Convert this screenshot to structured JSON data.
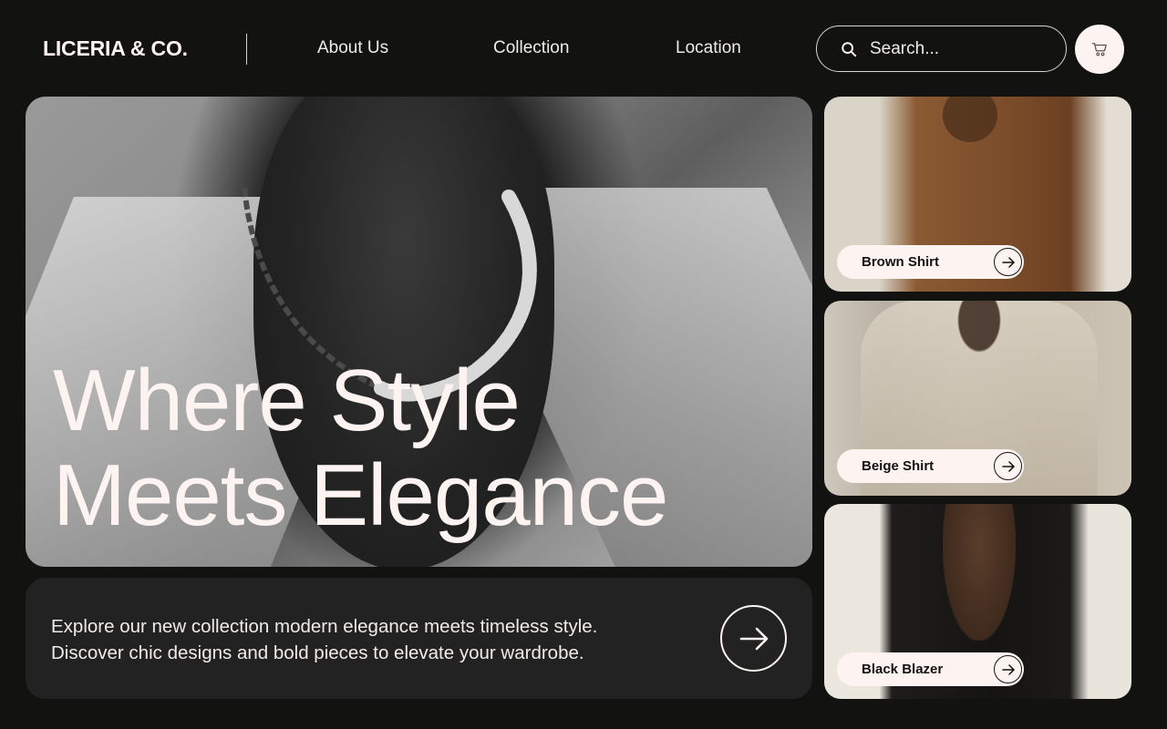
{
  "header": {
    "brand": "LICERIA & CO.",
    "nav": [
      {
        "label": "About Us"
      },
      {
        "label": "Collection"
      },
      {
        "label": "Location"
      }
    ],
    "search": {
      "placeholder": "Search...",
      "value": "",
      "icon": "search-icon"
    },
    "cart_icon": "cart-icon"
  },
  "hero": {
    "title_line1": "Where Style",
    "title_line2": "Meets Elegance"
  },
  "info": {
    "line1": "Explore our new collection modern elegance meets timeless style.",
    "line2": "Discover chic designs and bold pieces to elevate your wardrobe.",
    "button_icon": "arrow-right-icon"
  },
  "products": [
    {
      "name": "Brown Shirt"
    },
    {
      "name": "Beige Shirt"
    },
    {
      "name": "Black Blazer"
    }
  ],
  "colors": {
    "background": "#121211",
    "panel": "#222222",
    "cream": "#fdf4f1"
  }
}
